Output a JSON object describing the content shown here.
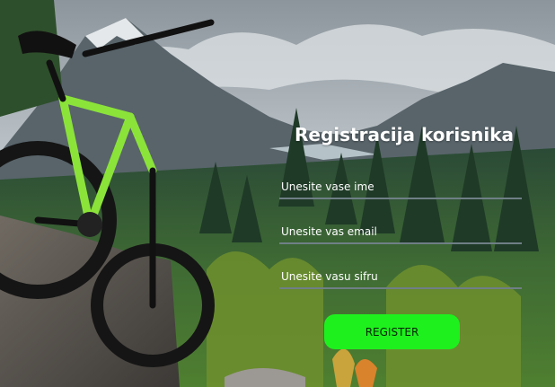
{
  "form": {
    "title": "Registracija korisnika",
    "name_placeholder": "Unesite vase ime",
    "email_placeholder": "Unesite vas email",
    "password_placeholder": "Unesite vasu sifru",
    "submit_label": "REGISTER"
  },
  "colors": {
    "button_bg": "#1ef01e",
    "input_underline": "#6f7f86",
    "text": "#ffffff"
  }
}
